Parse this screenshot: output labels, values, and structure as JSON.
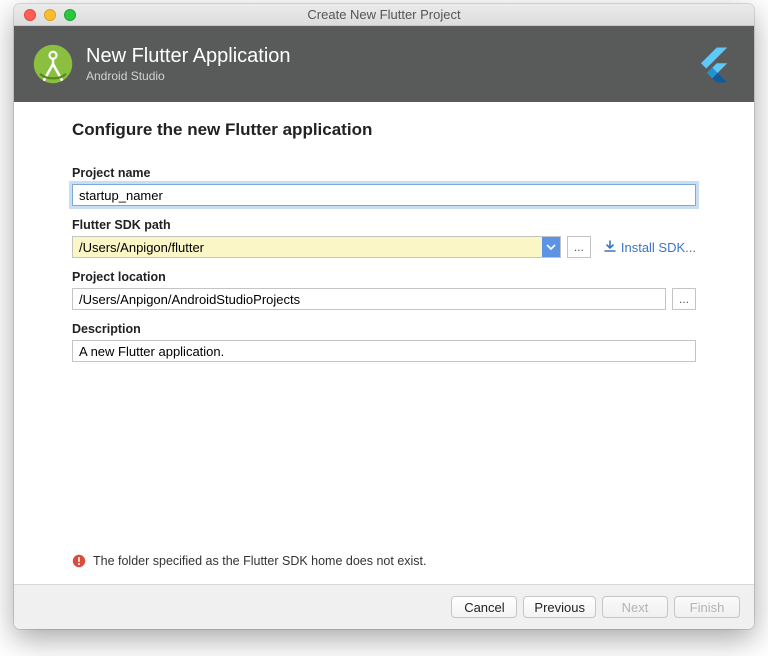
{
  "window_title": "Create New Flutter Project",
  "header": {
    "title": "New Flutter Application",
    "subtitle": "Android Studio"
  },
  "section_title": "Configure the new Flutter application",
  "fields": {
    "project_name": {
      "label": "Project name",
      "value": "startup_namer"
    },
    "sdk_path": {
      "label": "Flutter SDK path",
      "value": "/Users/Anpigon/flutter",
      "install_label": "Install SDK..."
    },
    "location": {
      "label": "Project location",
      "value": "/Users/Anpigon/AndroidStudioProjects"
    },
    "description": {
      "label": "Description",
      "value": "A new Flutter application."
    }
  },
  "error_message": "The folder specified as the Flutter SDK home does not exist.",
  "buttons": {
    "cancel": "Cancel",
    "previous": "Previous",
    "next": "Next",
    "finish": "Finish"
  }
}
